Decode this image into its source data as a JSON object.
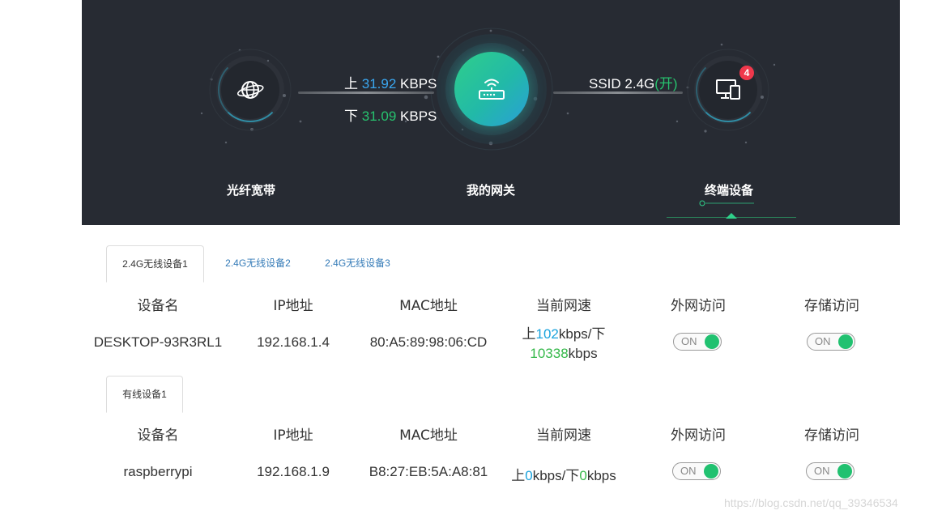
{
  "hero": {
    "upload_prefix": "上",
    "upload_value": "31.92",
    "upload_unit": "KBPS",
    "download_prefix": "下",
    "download_value": "31.09",
    "download_unit": "KBPS",
    "ssid_text": "SSID 2.4G",
    "ssid_state": "(开)",
    "device_count": "4",
    "labels": {
      "fiber": "光纤宽带",
      "gateway": "我的网关",
      "terminal": "终端设备"
    }
  },
  "wireless": {
    "tabs": [
      {
        "label": "2.4G无线设备1",
        "active": true
      },
      {
        "label": "2.4G无线设备2",
        "active": false
      },
      {
        "label": "2.4G无线设备3",
        "active": false
      }
    ],
    "headers": [
      "设备名",
      "IP地址",
      "MAC地址",
      "当前网速",
      "外网访问",
      "存储访问"
    ],
    "rows": [
      {
        "name": "DESKTOP-93R3RL1",
        "ip": "192.168.1.4",
        "mac": "80:A5:89:98:06:CD",
        "up_prefix": "上",
        "up_value": "102",
        "up_unit": "kbps/下",
        "down_value": "10338",
        "down_unit": "kbps",
        "internet": "ON",
        "storage": "ON"
      }
    ]
  },
  "wired": {
    "tabs": [
      {
        "label": "有线设备1",
        "active": true
      }
    ],
    "headers": [
      "设备名",
      "IP地址",
      "MAC地址",
      "当前网速",
      "外网访问",
      "存储访问"
    ],
    "rows": [
      {
        "name": "raspberrypi",
        "ip": "192.168.1.9",
        "mac": "B8:27:EB:5A:A8:81",
        "up_prefix": "上",
        "up_value": "0",
        "up_unit": "kbps/下",
        "down_value": "0",
        "down_unit": "kbps",
        "internet": "ON",
        "storage": "ON"
      }
    ]
  },
  "watermark": "https://blog.csdn.net/qq_39346534",
  "colors": {
    "hero_bg": "#272b33",
    "upload_blue": "#3aa7f0",
    "download_green": "#27c26e",
    "toggle_on": "#21c170",
    "badge_red": "#f0384c"
  }
}
